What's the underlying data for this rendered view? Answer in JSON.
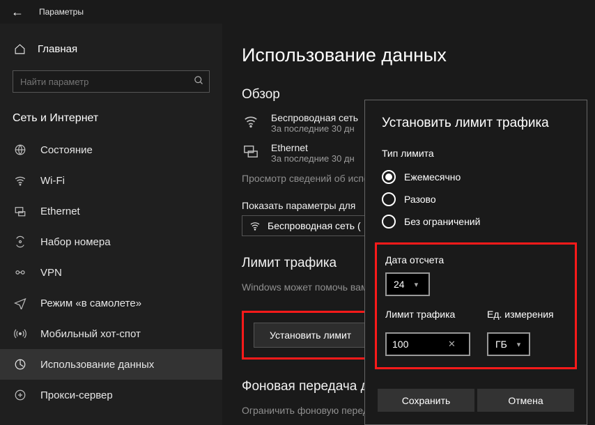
{
  "topbar": {
    "title": "Параметры"
  },
  "sidebar": {
    "home": "Главная",
    "search_placeholder": "Найти параметр",
    "category": "Сеть и Интернет",
    "items": [
      {
        "label": "Состояние"
      },
      {
        "label": "Wi-Fi"
      },
      {
        "label": "Ethernet"
      },
      {
        "label": "Набор номера"
      },
      {
        "label": "VPN"
      },
      {
        "label": "Режим «в самолете»"
      },
      {
        "label": "Мобильный хот-спот"
      },
      {
        "label": "Использование данных",
        "active": true
      },
      {
        "label": "Прокси-сервер"
      }
    ]
  },
  "main": {
    "page_title": "Использование данных",
    "overview": {
      "title": "Обзор",
      "networks": [
        {
          "label": "Беспроводная сеть",
          "sub": "За последние 30 дн"
        },
        {
          "label": "Ethernet",
          "sub": "За последние 30 дн"
        }
      ],
      "view_details": "Просмотр сведений об использовании для каждого приложения"
    },
    "show_for_label": "Показать параметры для",
    "show_for_value": "Беспроводная сеть (",
    "limit": {
      "title": "Лимит трафика",
      "desc": "Windows может помочь вам изменить ваш тарифный план",
      "button": "Установить лимит"
    },
    "background": {
      "title": "Фоновая передача данных",
      "desc": "Ограничить фоновую передачу данных для сокращения"
    }
  },
  "dialog": {
    "title": "Установить лимит трафика",
    "type_label": "Тип лимита",
    "type_options": [
      {
        "label": "Ежемесячно",
        "selected": true
      },
      {
        "label": "Разово",
        "selected": false
      },
      {
        "label": "Без ограничений",
        "selected": false
      }
    ],
    "date_label": "Дата отсчета",
    "date_value": "24",
    "limit_label": "Лимит трафика",
    "limit_value": "100",
    "unit_label": "Ед. измерения",
    "unit_value": "ГБ",
    "save": "Сохранить",
    "cancel": "Отмена"
  }
}
